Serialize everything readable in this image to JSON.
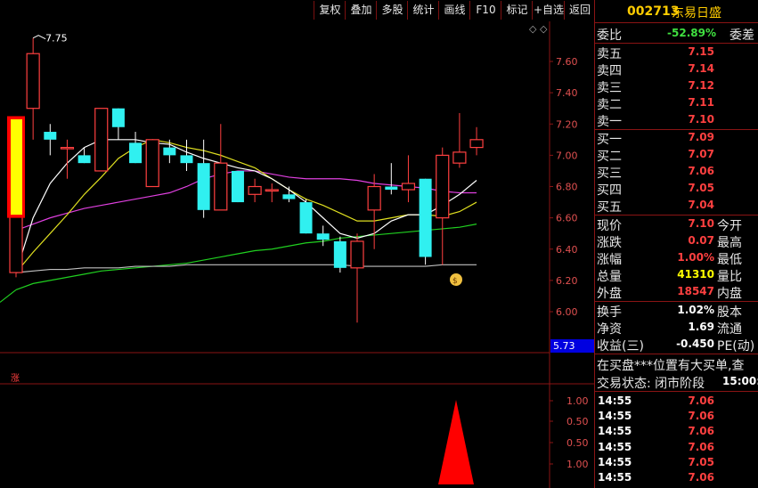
{
  "toolbar": {
    "buttons": [
      "复权",
      "叠加",
      "多股",
      "统计",
      "画线",
      "F10",
      "标记",
      "+自选",
      "返回"
    ]
  },
  "main_chart": {
    "ticks": [
      "7.60",
      "7.40",
      "7.20",
      "7.00",
      "6.80",
      "6.60",
      "6.40",
      "6.20",
      "6.00"
    ],
    "high_label": "7.75",
    "current_price_label": "5.73",
    "zhang_label": "涨"
  },
  "sub_chart": {
    "ticks": [
      "1.00",
      "0.50",
      "0.50",
      "1.00"
    ]
  },
  "chart_data": {
    "type": "candlestick",
    "title": "",
    "ylim": [
      5.8,
      7.8
    ],
    "candles": [
      {
        "o": 6.25,
        "h": 6.95,
        "l": 6.22,
        "c": 6.95
      },
      {
        "o": 7.3,
        "h": 7.75,
        "l": 7.1,
        "c": 7.65
      },
      {
        "o": 7.15,
        "h": 7.2,
        "l": 7.0,
        "c": 7.1
      },
      {
        "o": 7.05,
        "h": 7.1,
        "l": 6.85,
        "c": 7.05
      },
      {
        "o": 7.0,
        "h": 7.05,
        "l": 6.95,
        "c": 6.95
      },
      {
        "o": 6.9,
        "h": 7.3,
        "l": 6.9,
        "c": 7.3
      },
      {
        "o": 7.3,
        "h": 7.3,
        "l": 7.1,
        "c": 7.18
      },
      {
        "o": 7.08,
        "h": 7.15,
        "l": 6.95,
        "c": 6.95
      },
      {
        "o": 6.8,
        "h": 7.1,
        "l": 6.8,
        "c": 7.1
      },
      {
        "o": 7.05,
        "h": 7.1,
        "l": 6.95,
        "c": 7.0
      },
      {
        "o": 7.0,
        "h": 7.1,
        "l": 6.9,
        "c": 6.95
      },
      {
        "o": 6.95,
        "h": 7.1,
        "l": 6.6,
        "c": 6.65
      },
      {
        "o": 6.65,
        "h": 7.2,
        "l": 6.65,
        "c": 6.95
      },
      {
        "o": 6.9,
        "h": 6.9,
        "l": 6.7,
        "c": 6.7
      },
      {
        "o": 6.75,
        "h": 6.85,
        "l": 6.7,
        "c": 6.8
      },
      {
        "o": 6.78,
        "h": 6.82,
        "l": 6.7,
        "c": 6.78
      },
      {
        "o": 6.75,
        "h": 6.8,
        "l": 6.7,
        "c": 6.72
      },
      {
        "o": 6.7,
        "h": 6.72,
        "l": 6.5,
        "c": 6.5
      },
      {
        "o": 6.5,
        "h": 6.55,
        "l": 6.42,
        "c": 6.46
      },
      {
        "o": 6.45,
        "h": 6.48,
        "l": 6.25,
        "c": 6.28
      },
      {
        "o": 6.28,
        "h": 6.5,
        "l": 5.93,
        "c": 6.45
      },
      {
        "o": 6.65,
        "h": 6.88,
        "l": 6.4,
        "c": 6.8
      },
      {
        "o": 6.8,
        "h": 6.95,
        "l": 6.75,
        "c": 6.78
      },
      {
        "o": 6.78,
        "h": 7.0,
        "l": 6.7,
        "c": 6.82
      },
      {
        "o": 6.85,
        "h": 6.85,
        "l": 6.3,
        "c": 6.35
      },
      {
        "o": 6.6,
        "h": 7.05,
        "l": 6.3,
        "c": 7.0
      },
      {
        "o": 6.95,
        "h": 7.27,
        "l": 6.92,
        "c": 7.02
      },
      {
        "o": 7.05,
        "h": 7.18,
        "l": 7.0,
        "c": 7.1
      }
    ],
    "ma_white": [
      6.25,
      6.6,
      6.82,
      6.95,
      7.05,
      7.1,
      7.1,
      7.1,
      7.08,
      7.07,
      7.02,
      6.98,
      6.95,
      6.92,
      6.9,
      6.85,
      6.78,
      6.7,
      6.6,
      6.5,
      6.47,
      6.5,
      6.58,
      6.62,
      6.62,
      6.68,
      6.75,
      6.84
    ],
    "ma_yellow": [
      6.25,
      6.38,
      6.5,
      6.62,
      6.75,
      6.86,
      6.98,
      7.05,
      7.1,
      7.08,
      7.05,
      7.03,
      7.0,
      6.96,
      6.92,
      6.85,
      6.78,
      6.72,
      6.68,
      6.63,
      6.58,
      6.58,
      6.6,
      6.62,
      6.62,
      6.61,
      6.64,
      6.7
    ],
    "ma_magenta": [
      6.52,
      6.56,
      6.6,
      6.63,
      6.66,
      6.68,
      6.7,
      6.72,
      6.74,
      6.76,
      6.8,
      6.85,
      6.88,
      6.9,
      6.9,
      6.88,
      6.86,
      6.85,
      6.85,
      6.85,
      6.84,
      6.82,
      6.81,
      6.8,
      6.79,
      6.77,
      6.76,
      6.76
    ],
    "ma_green": [
      6.14,
      6.18,
      6.2,
      6.22,
      6.24,
      6.26,
      6.27,
      6.28,
      6.29,
      6.3,
      6.31,
      6.33,
      6.35,
      6.37,
      6.39,
      6.4,
      6.42,
      6.44,
      6.45,
      6.47,
      6.48,
      6.49,
      6.5,
      6.51,
      6.52,
      6.53,
      6.54,
      6.56
    ],
    "ma_gray": [
      6.25,
      6.26,
      6.27,
      6.27,
      6.28,
      6.28,
      6.28,
      6.29,
      6.29,
      6.29,
      6.3,
      6.3,
      6.3,
      6.3,
      6.3,
      6.3,
      6.3,
      6.3,
      6.3,
      6.3,
      6.29,
      6.29,
      6.29,
      6.29,
      6.29,
      6.3,
      6.3,
      6.3
    ]
  },
  "quote": {
    "code": "002713",
    "name": "东易日盛",
    "weibi_label": "委比",
    "weibi_value": "-52.89%",
    "weicha_label": "委差",
    "sells": [
      {
        "label": "卖五",
        "price": "7.15"
      },
      {
        "label": "卖四",
        "price": "7.14"
      },
      {
        "label": "卖三",
        "price": "7.12"
      },
      {
        "label": "卖二",
        "price": "7.11"
      },
      {
        "label": "卖一",
        "price": "7.10"
      }
    ],
    "buys": [
      {
        "label": "买一",
        "price": "7.09"
      },
      {
        "label": "买二",
        "price": "7.07"
      },
      {
        "label": "买三",
        "price": "7.06"
      },
      {
        "label": "买四",
        "price": "7.05"
      },
      {
        "label": "买五",
        "price": "7.04"
      }
    ],
    "stats": [
      {
        "label": "现价",
        "value": "7.10",
        "label2": "今开"
      },
      {
        "label": "涨跌",
        "value": "0.07",
        "label2": "最高"
      },
      {
        "label": "涨幅",
        "value": "1.00%",
        "label2": "最低"
      },
      {
        "label": "总量",
        "value": "41310",
        "label2": "量比"
      },
      {
        "label": "外盘",
        "value": "18547",
        "label2": "内盘"
      }
    ],
    "stats2": [
      {
        "label": "换手",
        "value": "1.02%",
        "label2": "股本"
      },
      {
        "label": "净资",
        "value": "1.69",
        "label2": "流通"
      },
      {
        "label": "收益(三)",
        "value": "-0.450",
        "label2": "PE(动)"
      }
    ],
    "notice": "在买盘***位置有大买单,查",
    "status_label": "交易状态: 闭市阶段",
    "status_time": "15:00:",
    "ticks": [
      {
        "time": "14:55",
        "price": "7.06"
      },
      {
        "time": "14:55",
        "price": "7.06"
      },
      {
        "time": "14:55",
        "price": "7.06"
      },
      {
        "time": "14:55",
        "price": "7.06"
      },
      {
        "time": "14:55",
        "price": "7.05"
      },
      {
        "time": "14:55",
        "price": "7.06"
      }
    ]
  },
  "colors": {
    "up": "#ff4040",
    "down": "#30f0f0",
    "accent_red": "#ff3c3c",
    "green": "#40e040",
    "yellow": "#ffff00",
    "label": "#e6e6e6"
  }
}
